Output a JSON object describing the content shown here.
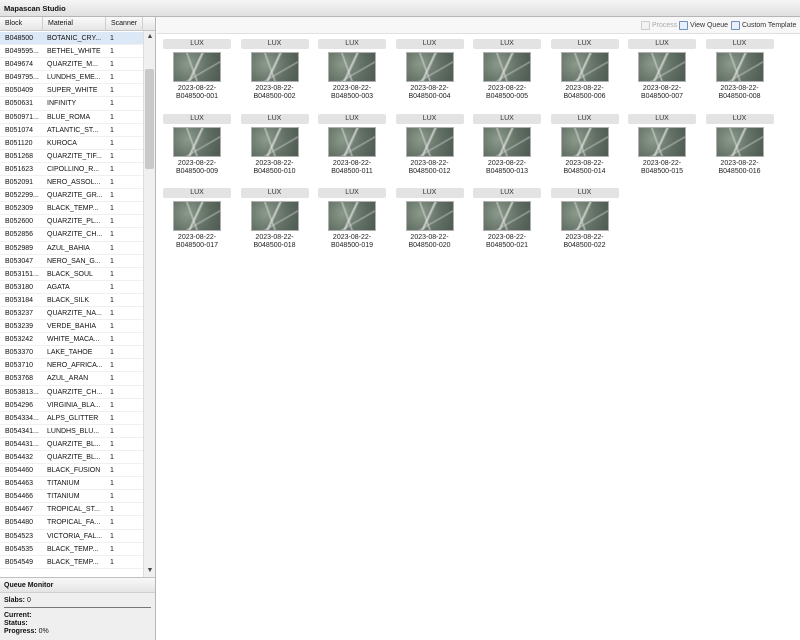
{
  "app": {
    "title": "Mapascan Studio"
  },
  "grid": {
    "columns": {
      "block": "Block",
      "material": "Material",
      "scanner": "Scanner"
    },
    "rows": [
      {
        "block": "B048500",
        "material": "BOTANIC_CRY...",
        "scanner": "1"
      },
      {
        "block": "B049595...",
        "material": "BETHEL_WHITE",
        "scanner": "1"
      },
      {
        "block": "B049674",
        "material": "QUARZITE_M...",
        "scanner": "1"
      },
      {
        "block": "B049795...",
        "material": "LUNDHS_EME...",
        "scanner": "1"
      },
      {
        "block": "B050409",
        "material": "SUPER_WHITE",
        "scanner": "1"
      },
      {
        "block": "B050631",
        "material": "INFINITY",
        "scanner": "1"
      },
      {
        "block": "B050971...",
        "material": "BLUE_ROMA",
        "scanner": "1"
      },
      {
        "block": "B051074",
        "material": "ATLANTIC_ST...",
        "scanner": "1"
      },
      {
        "block": "B051120",
        "material": "KUROCA",
        "scanner": "1"
      },
      {
        "block": "B051268",
        "material": "QUARZITE_TIF...",
        "scanner": "1"
      },
      {
        "block": "B051623",
        "material": "CIPOLLINO_R...",
        "scanner": "1"
      },
      {
        "block": "B052091",
        "material": "NERO_ASSOL...",
        "scanner": "1"
      },
      {
        "block": "B052299...",
        "material": "QUARZITE_GR...",
        "scanner": "1"
      },
      {
        "block": "B052309",
        "material": "BLACK_TEMP...",
        "scanner": "1"
      },
      {
        "block": "B052600",
        "material": "QUARZITE_PL...",
        "scanner": "1"
      },
      {
        "block": "B052856",
        "material": "QUARZITE_CH...",
        "scanner": "1"
      },
      {
        "block": "B052989",
        "material": "AZUL_BAHIA",
        "scanner": "1"
      },
      {
        "block": "B053047",
        "material": "NERO_SAN_G...",
        "scanner": "1"
      },
      {
        "block": "B053151...",
        "material": "BLACK_SOUL",
        "scanner": "1"
      },
      {
        "block": "B053180",
        "material": "AGATA",
        "scanner": "1"
      },
      {
        "block": "B053184",
        "material": "BLACK_SILK",
        "scanner": "1"
      },
      {
        "block": "B053237",
        "material": "QUARZITE_NA...",
        "scanner": "1"
      },
      {
        "block": "B053239",
        "material": "VERDE_BAHIA",
        "scanner": "1"
      },
      {
        "block": "B053242",
        "material": "WHITE_MACA...",
        "scanner": "1"
      },
      {
        "block": "B053370",
        "material": "LAKE_TAHOE",
        "scanner": "1"
      },
      {
        "block": "B053710",
        "material": "NERO_AFRICA...",
        "scanner": "1"
      },
      {
        "block": "B053768",
        "material": "AZUL_ARAN",
        "scanner": "1"
      },
      {
        "block": "B053813...",
        "material": "QUARZITE_CH...",
        "scanner": "1"
      },
      {
        "block": "B054296",
        "material": "VIRGINIA_BLA...",
        "scanner": "1"
      },
      {
        "block": "B054334...",
        "material": "ALPS_GLITTER",
        "scanner": "1"
      },
      {
        "block": "B054341...",
        "material": "LUNDHS_BLU...",
        "scanner": "1"
      },
      {
        "block": "B054431...",
        "material": "QUARZITE_BL...",
        "scanner": "1"
      },
      {
        "block": "B054432",
        "material": "QUARZITE_BL...",
        "scanner": "1"
      },
      {
        "block": "B054460",
        "material": "BLACK_FUSION",
        "scanner": "1"
      },
      {
        "block": "B054463",
        "material": "TITANIUM",
        "scanner": "1"
      },
      {
        "block": "B054466",
        "material": "TITANIUM",
        "scanner": "1"
      },
      {
        "block": "B054467",
        "material": "TROPICAL_ST...",
        "scanner": "1"
      },
      {
        "block": "B054480",
        "material": "TROPICAL_FA...",
        "scanner": "1"
      },
      {
        "block": "B054523",
        "material": "VICTORIA_FAL...",
        "scanner": "1"
      },
      {
        "block": "B054535",
        "material": "BLACK_TEMP...",
        "scanner": "1"
      },
      {
        "block": "B054549",
        "material": "BLACK_TEMP...",
        "scanner": "1"
      }
    ],
    "selected_index": 0
  },
  "queue_monitor": {
    "title": "Queue Monitor",
    "slabs_label": "Slabs:",
    "slabs_value": "0",
    "current_label": "Current:",
    "current_value": "",
    "status_label": "Status:",
    "status_value": "",
    "progress_label": "Progress:",
    "progress_value": "0%"
  },
  "toolbar": {
    "process_label": "Process",
    "view_queue_label": "View Queue",
    "custom_template_label": "Custom Template"
  },
  "slabs": [
    {
      "header": "LUX",
      "date": "2023-08-22-",
      "id": "B048500-001"
    },
    {
      "header": "LUX",
      "date": "2023-08-22-",
      "id": "B048500-002"
    },
    {
      "header": "LUX",
      "date": "2023-08-22-",
      "id": "B048500-003"
    },
    {
      "header": "LUX",
      "date": "2023-08-22-",
      "id": "B048500-004"
    },
    {
      "header": "LUX",
      "date": "2023-08-22-",
      "id": "B048500-005"
    },
    {
      "header": "LUX",
      "date": "2023-08-22-",
      "id": "B048500-006"
    },
    {
      "header": "LUX",
      "date": "2023-08-22-",
      "id": "B048500-007"
    },
    {
      "header": "LUX",
      "date": "2023-08-22-",
      "id": "B048500-008"
    },
    {
      "header": "LUX",
      "date": "2023-08-22-",
      "id": "B048500-009"
    },
    {
      "header": "LUX",
      "date": "2023-08-22-",
      "id": "B048500-010"
    },
    {
      "header": "LUX",
      "date": "2023-08-22-",
      "id": "B048500-011"
    },
    {
      "header": "LUX",
      "date": "2023-08-22-",
      "id": "B048500-012"
    },
    {
      "header": "LUX",
      "date": "2023-08-22-",
      "id": "B048500-013"
    },
    {
      "header": "LUX",
      "date": "2023-08-22-",
      "id": "B048500-014"
    },
    {
      "header": "LUX",
      "date": "2023-08-22-",
      "id": "B048500-015"
    },
    {
      "header": "LUX",
      "date": "2023-08-22-",
      "id": "B048500-016"
    },
    {
      "header": "LUX",
      "date": "2023-08-22-",
      "id": "B048500-017"
    },
    {
      "header": "LUX",
      "date": "2023-08-22-",
      "id": "B048500-018"
    },
    {
      "header": "LUX",
      "date": "2023-08-22-",
      "id": "B048500-019"
    },
    {
      "header": "LUX",
      "date": "2023-08-22-",
      "id": "B048500-020"
    },
    {
      "header": "LUX",
      "date": "2023-08-22-",
      "id": "B048500-021"
    },
    {
      "header": "LUX",
      "date": "2023-08-22-",
      "id": "B048500-022"
    }
  ]
}
